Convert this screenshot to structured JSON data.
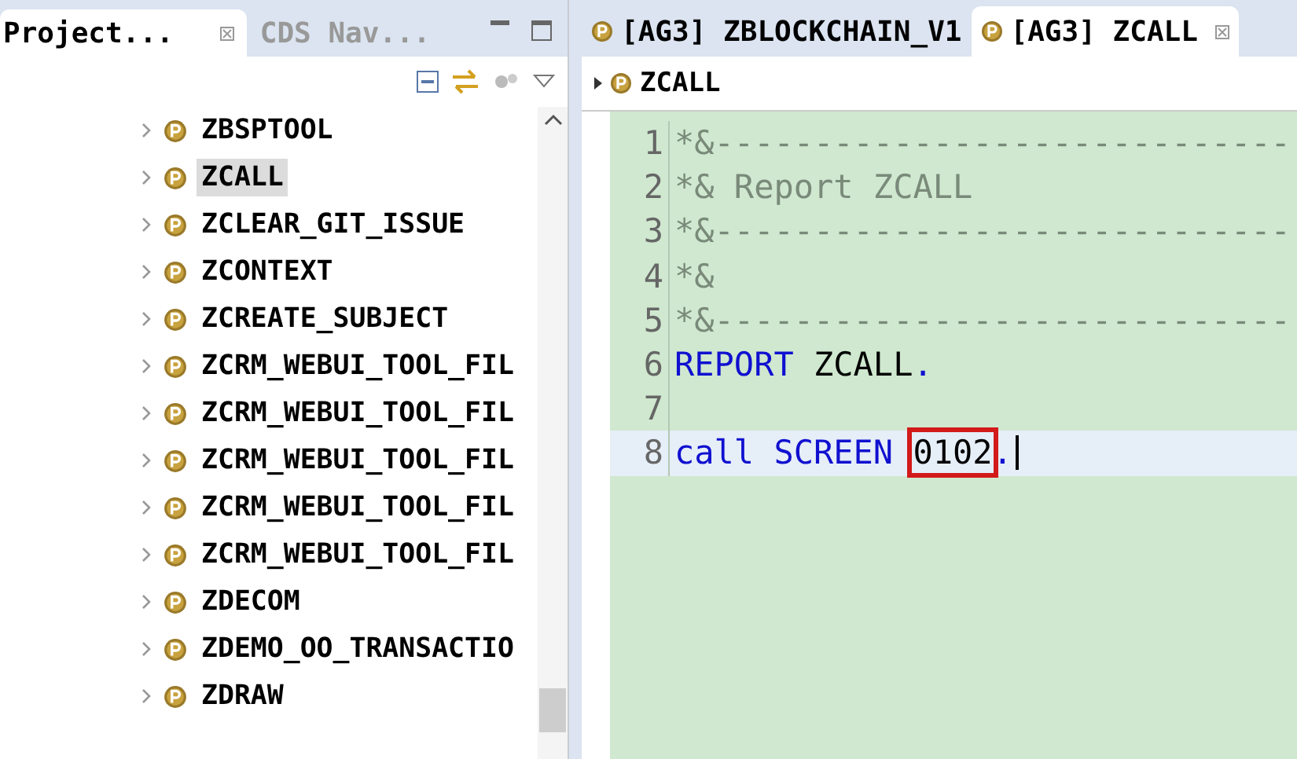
{
  "left_panel": {
    "tabs": [
      {
        "label": "Project...",
        "selected": true,
        "closable": true
      },
      {
        "label": "CDS Nav...",
        "selected": false,
        "closable": false
      }
    ],
    "tree_items": [
      {
        "label": "ZBSPTOOL",
        "selected": false
      },
      {
        "label": "ZCALL",
        "selected": true
      },
      {
        "label": "ZCLEAR_GIT_ISSUE",
        "selected": false
      },
      {
        "label": "ZCONTEXT",
        "selected": false
      },
      {
        "label": "ZCREATE_SUBJECT",
        "selected": false
      },
      {
        "label": "ZCRM_WEBUI_TOOL_FIL",
        "selected": false
      },
      {
        "label": "ZCRM_WEBUI_TOOL_FIL",
        "selected": false
      },
      {
        "label": "ZCRM_WEBUI_TOOL_FIL",
        "selected": false
      },
      {
        "label": "ZCRM_WEBUI_TOOL_FIL",
        "selected": false
      },
      {
        "label": "ZCRM_WEBUI_TOOL_FIL",
        "selected": false
      },
      {
        "label": "ZDECOM",
        "selected": false
      },
      {
        "label": "ZDEMO_OO_TRANSACTIO",
        "selected": false
      },
      {
        "label": "ZDRAW",
        "selected": false
      }
    ]
  },
  "editor": {
    "tabs": [
      {
        "label": "[AG3] ZBLOCKCHAIN_V1",
        "selected": false,
        "closable": false
      },
      {
        "label": "[AG3] ZCALL",
        "selected": true,
        "closable": true
      }
    ],
    "breadcrumb": "ZCALL",
    "lines": [
      {
        "number": "1",
        "current": false,
        "tokens": [
          {
            "kind": "comment",
            "text": "*&-----------------------------"
          }
        ]
      },
      {
        "number": "2",
        "current": false,
        "tokens": [
          {
            "kind": "comment",
            "text": "*& Report ZCALL"
          }
        ]
      },
      {
        "number": "3",
        "current": false,
        "tokens": [
          {
            "kind": "comment",
            "text": "*&-----------------------------"
          }
        ]
      },
      {
        "number": "4",
        "current": false,
        "tokens": [
          {
            "kind": "comment",
            "text": "*&"
          }
        ]
      },
      {
        "number": "5",
        "current": false,
        "tokens": [
          {
            "kind": "comment",
            "text": "*&-----------------------------"
          }
        ]
      },
      {
        "number": "6",
        "current": false,
        "tokens": [
          {
            "kind": "keyword",
            "text": "REPORT"
          },
          {
            "kind": "plain",
            "text": " ZCALL"
          },
          {
            "kind": "keyword",
            "text": "."
          }
        ]
      },
      {
        "number": "7",
        "current": false
      },
      {
        "number": "8",
        "current": true,
        "tokens": [
          {
            "kind": "keyword",
            "text": "call"
          },
          {
            "kind": "keyword",
            "text": " SCREEN "
          },
          {
            "kind": "plain",
            "text": "0102",
            "highlighted": true
          },
          {
            "kind": "keyword",
            "text": "."
          }
        ]
      }
    ]
  }
}
